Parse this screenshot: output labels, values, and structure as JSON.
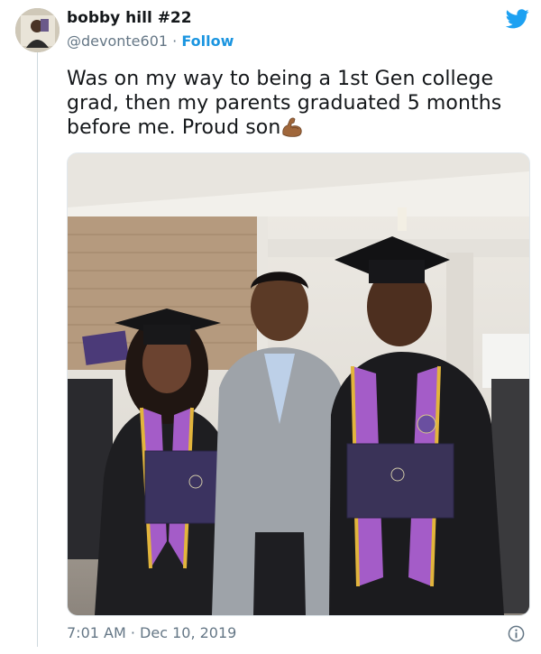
{
  "author": {
    "display_name": "bobby hill #22",
    "handle": "@devonte601",
    "separator": "·",
    "follow_label": "Follow"
  },
  "tweet": {
    "text": "Was on my way to being a 1st Gen college grad, then my parents graduated 5 months before me. Proud son",
    "emoji": "flexed-biceps-icon"
  },
  "meta": {
    "time": "7:01 AM",
    "separator": "·",
    "date": "Dec 10, 2019"
  },
  "colors": {
    "accent": "#1b95e0",
    "secondary_text": "#657786",
    "primary_text": "#14171a"
  },
  "icons": [
    "twitter-bird-icon",
    "info-icon"
  ]
}
